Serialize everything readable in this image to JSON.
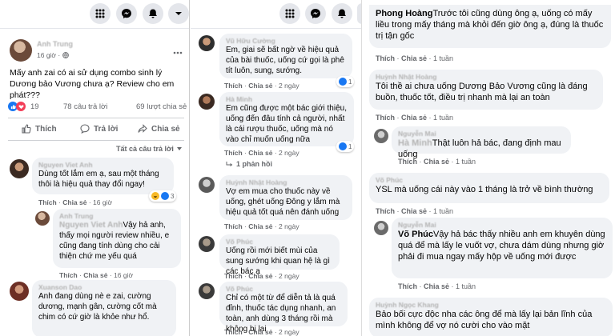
{
  "post": {
    "author": "Anh Trung",
    "time": "16 giờ ·",
    "text": "Mấy anh zai có ai sử dụng combo sinh lý Dương bảo Vương chưa ạ? Review cho em phát???",
    "reaction_count": "19",
    "comments_count": "78 câu trả lời",
    "shares_count": "69 lượt chia sẻ",
    "actions": {
      "like": "Thích",
      "comment": "Trả lời",
      "share": "Chia sẻ"
    },
    "sort_label": "Tất cả câu trả lời"
  },
  "panel1_comments": [
    {
      "name": "Nguyen Viet Anh",
      "text": "Dùng tốt lắm em ạ, sau một tháng thôi là hiệu quả thay đổi ngay!",
      "meta_like": "Thích",
      "meta_share": "Chia sẻ",
      "meta_time": "16 giờ",
      "reaction_count": "3"
    },
    {
      "name": "Anh Trung",
      "mention": "Nguyen Viet Anh",
      "text": "Vậy hả anh, thấy mọi người review nhiều, e cũng đang tính dùng cho cải thiện chứ me yếu quá",
      "meta_like": "Thích",
      "meta_share": "Chia sẻ",
      "meta_time": "16 giờ"
    },
    {
      "name": "Xuanson Dao",
      "text": "Anh đang dùng nè e zai, cường dương, mạnh gân, cường cốt mà chim có cứ giờ là khỏe như hổ."
    }
  ],
  "panel2_comments": [
    {
      "name": "Vũ Hữu Cường",
      "text": "Em, giai sẽ bất ngờ về hiệu quả của bài thuốc, uống cứ gọi là phê tít luôn, sung, sướng.",
      "meta_like": "Thích",
      "meta_share": "Chia sẻ",
      "meta_time": "2 ngày",
      "reaction_count": "1"
    },
    {
      "name": "Hà Minh",
      "text": "Em cũng được một bác giới thiệu, uống đến đâu tính cả người, nhất là cái rượu thuốc, uống mà nó vào chỉ muốn uống nữa",
      "meta_like": "Thích",
      "meta_share": "Chia sẻ",
      "meta_time": "2 ngày",
      "reaction_count": "1",
      "replies": "1 phản hồi"
    },
    {
      "name": "Huỳnh Nhật Hoàng",
      "text": "Vợ em mua cho thuốc này về uống, ghét uống Đông y lắm mà hiệu quả tốt quá nên đánh uống",
      "meta_like": "Thích",
      "meta_share": "Chia sẻ",
      "meta_time": "2 ngày"
    },
    {
      "name": "Võ Phúc",
      "text": "Uống rồi mới biết mùi của sung sướng khi quan hệ là gì các bác ạ",
      "meta_like": "Thích",
      "meta_share": "Chia sẻ",
      "meta_time": "2 ngày"
    },
    {
      "name": "Võ Phúc",
      "text": "Chỉ có một từ để diễn tả là quá đỉnh, thuốc tác dụng nhanh, an toàn, anh dùng 3 tháng rồi mà không bị lại",
      "meta_like": "Thích",
      "meta_share": "Chia sẻ",
      "meta_time": "2 ngày"
    }
  ],
  "panel3_comments": [
    {
      "name": "Phong Hoàng",
      "text": "Trước tôi cũng dùng ông ạ, uống có mấy liều trong mấy tháng mà khỏi đến giờ ông ạ, đúng là thuốc trị tận gốc",
      "meta_like": "Thích",
      "meta_share": "Chia sẻ",
      "meta_time": "1 tuần"
    },
    {
      "name": "Huỳnh Nhật Hoàng",
      "text": "Tôi thề ai chưa uống Dương Bảo Vương cũng là đáng buồn, thuốc tốt, điều trị nhanh mà lại an toàn",
      "meta_like": "Thích",
      "meta_share": "Chia sẻ",
      "meta_time": "1 tuần"
    },
    {
      "name": "Nguyễn Mai",
      "mention": "Hà Minh",
      "text": "Thật luôn hả bác, đang định mau uống",
      "meta_like": "Thích",
      "meta_share": "Chia sẻ",
      "meta_time": "1 tuần"
    },
    {
      "name": "Võ Phúc",
      "text": "YSL mà uống cái này vào 1 tháng là trở về bình thường",
      "meta_like": "Thích",
      "meta_share": "Chia sẻ",
      "meta_time": "1 tuần"
    },
    {
      "name": "Nguyễn Mai",
      "mention": "Võ Phúc",
      "text": "Vậy hả bác thấy nhiều anh em khuyên dùng quá để mà lấy le vuốt vợ, chưa dám dùng nhưng giờ phải đi mua ngay mấy hộp về uống mới được",
      "meta_like": "Thích",
      "meta_share": "Chia sẻ",
      "meta_time": "1 tuần"
    },
    {
      "name": "Huỳnh Ngọc Khang",
      "text": "Bảo bối cực độc nha các ông để mà lấy lại bản lĩnh của mình không để vợ nó cười cho vào mặt"
    }
  ],
  "colors": {
    "blue": "#1877f2",
    "bubble": "#f0f2f5",
    "meta": "#65676b"
  },
  "icons": [
    "grid-icon",
    "messenger-icon",
    "bell-icon",
    "caret-down-icon",
    "like-icon",
    "comment-icon",
    "share-icon",
    "globe-icon",
    "more-icon"
  ]
}
